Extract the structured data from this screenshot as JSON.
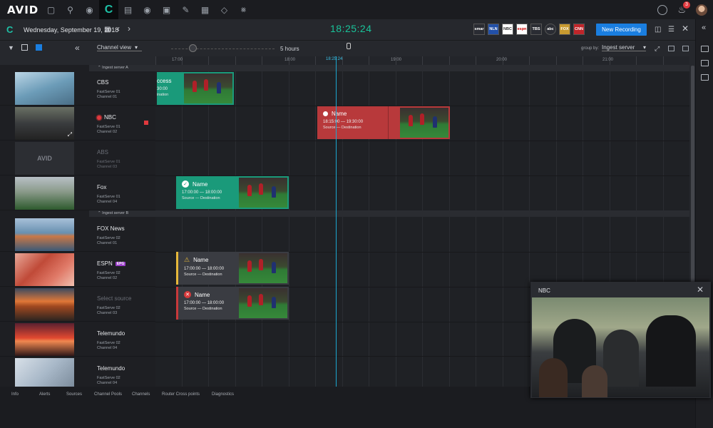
{
  "topbar": {
    "logo": "AVID",
    "notification_count": "3",
    "icons": [
      "folder-icon",
      "search-icon",
      "user-circle-icon",
      "capture-icon",
      "server-icon",
      "chat-icon",
      "edit-doc-icon",
      "pencil-doc-icon",
      "media-icon",
      "route-icon",
      "share-icon"
    ]
  },
  "subheader": {
    "date": "Wednesday, September 19, 2018",
    "clock": "18:25:24",
    "new_recording": "New Recording",
    "networks": [
      "smar",
      "NLN",
      "NBC",
      "espn",
      "TBS",
      "abc",
      "FOX",
      "CNN"
    ]
  },
  "toolbar": {
    "view": "Channel view",
    "duration": "5 hours",
    "group_by_label": "group by:",
    "group_by_value": "Ingest server"
  },
  "timeline": {
    "ticks": [
      "17:00",
      "18:00",
      "18:25:24",
      "19:00",
      "20:00",
      "21:00"
    ]
  },
  "groups": [
    "Ingest server A",
    "Ingest server B"
  ],
  "channels": [
    {
      "name": "CBS",
      "server": "FastServe 01",
      "channel": "Channel 01"
    },
    {
      "name": "NBC",
      "server": "FastServe 01",
      "channel": "Channel 02"
    },
    {
      "name": "ABS",
      "server": "FastServe 01",
      "channel": "Channel 03"
    },
    {
      "name": "Fox",
      "server": "FastServe 01",
      "channel": "Channel 04"
    },
    {
      "name": "FOX News",
      "server": "FastServe 02",
      "channel": "Channel 01"
    },
    {
      "name": "ESPN",
      "server": "FastServe 02",
      "channel": "Channel 02",
      "tag": "EPG"
    },
    {
      "name": "Select source",
      "server": "FastServe 02",
      "channel": "Channel 03"
    },
    {
      "name": "Telemundo",
      "server": "FastServe 02",
      "channel": "Channel 04"
    },
    {
      "name": "Telemundo",
      "server": "FastServe 02",
      "channel": "Channel 04"
    }
  ],
  "recordings": {
    "cbs": {
      "name": "ccess",
      "time": "30:00",
      "source": "ination"
    },
    "nbc": {
      "name": "Name",
      "time": "18:15:00 — 19:30:00",
      "source": "Source — Destination"
    },
    "fox": {
      "name": "Name",
      "time": "17:00:00 — 18:00:00",
      "source": "Source — Destination"
    },
    "espn": {
      "name": "Name",
      "time": "17:00:00 — 18:00:00",
      "source": "Source — Destination"
    },
    "select": {
      "name": "Name",
      "time": "17:00:00 — 18:00:00",
      "source": "Source — Destination"
    }
  },
  "preview": {
    "title": "NBC"
  },
  "bottom_tabs": [
    "Info",
    "Alerts",
    "Sources",
    "Channel Pools",
    "Channels",
    "Router Cross points",
    "Diagnostics"
  ],
  "colors": {
    "accent": "#1ec0a6",
    "success": "#1a9a7a",
    "error": "#b8393b",
    "warning": "#e6b83a",
    "primary": "#1a7ee0"
  }
}
